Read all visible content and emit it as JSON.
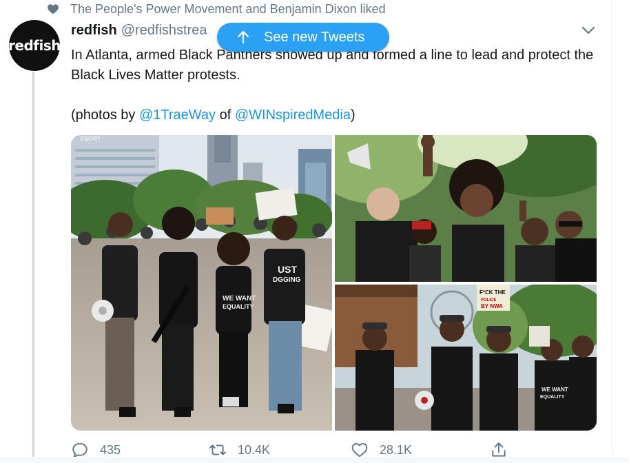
{
  "social_context": {
    "text": "The People's Power Movement and Benjamin Dixon liked",
    "icon": "heart-icon"
  },
  "author": {
    "avatar_text": "redfish",
    "display_name": "redfish",
    "handle": "@redfishstrea"
  },
  "new_tweets_button": {
    "label": "See new Tweets",
    "icon": "arrow-up-icon"
  },
  "tweet": {
    "text": "In Atlanta, armed Black Panthers showed up and formed a line to lead and protect the Black Lives Matter protests.",
    "credit_prefix": "(photos by ",
    "credit_mention_1": "@1TraeWay",
    "credit_middle": " of ",
    "credit_mention_2": "@WINspiredMedia",
    "credit_suffix": ")"
  },
  "media": {
    "photo_1": {
      "signs": [
        "EMORY",
        "UST",
        "DGGING",
        "WE WANT",
        "EQUALITY"
      ]
    },
    "photo_2": {},
    "photo_3": {
      "signs": [
        "F*CK THE",
        "POLICE",
        "BY NWA",
        "WE WANT",
        "EQUALITY"
      ]
    }
  },
  "actions": {
    "reply": {
      "count": "435",
      "icon": "reply-icon"
    },
    "retweet": {
      "count": "10.4K",
      "icon": "retweet-icon"
    },
    "like": {
      "count": "28.1K",
      "icon": "heart-icon"
    },
    "share": {
      "icon": "share-icon"
    }
  },
  "colors": {
    "accent": "#1da1f2",
    "pill": "#2aa1f2",
    "muted": "#657786",
    "link": "#1b95e0"
  }
}
